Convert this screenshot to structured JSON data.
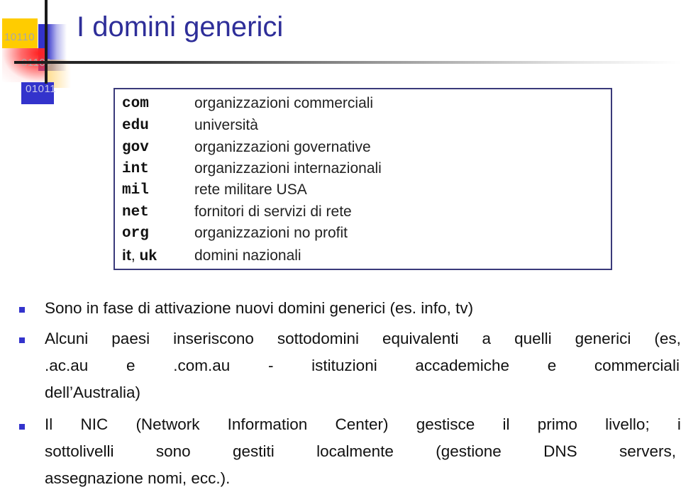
{
  "logo": {
    "binary_labels": [
      "10110",
      "01100",
      "01011"
    ],
    "colors": {
      "yellow": "#ffcc00",
      "blue": "#3333cc",
      "red": "#ff2020"
    }
  },
  "title": "I domini generici",
  "colors": {
    "title": "#2e2e99",
    "bullet": "#3333cc",
    "box_border": "#3a3a7a"
  },
  "tld_table": [
    {
      "code": "com",
      "desc": "organizzazioni commerciali"
    },
    {
      "code": "edu",
      "desc": "università"
    },
    {
      "code": "gov",
      "desc": "organizzazioni governative"
    },
    {
      "code": "int",
      "desc": "organizzazioni internazionali"
    },
    {
      "code": "mil",
      "desc": "rete militare USA"
    },
    {
      "code": "net",
      "desc": "fornitori di servizi di rete"
    },
    {
      "code": "org",
      "desc": "organizzazioni no profit"
    },
    {
      "code_a": "it",
      "code_sep": ", ",
      "code_b": "uk",
      "desc": "domini nazionali"
    }
  ],
  "bullets": [
    {
      "lines": [
        "Sono in fase di attivazione nuovi domini generici (es. info, tv)"
      ]
    },
    {
      "lines": [
        [
          "Alcuni",
          "paesi",
          "inseriscono",
          "sottodomini",
          "equivalenti",
          "a",
          "quelli",
          "generici",
          "(es,"
        ],
        [
          ".ac.au",
          "e",
          ".com.au",
          "-",
          "istituzioni",
          "accademiche",
          "e",
          "commerciali"
        ],
        "dell’Australia)"
      ]
    },
    {
      "lines": [
        [
          "Il",
          "NIC",
          "(Network",
          "Information",
          "Center)",
          "gestisce",
          "il",
          "primo",
          "livello;",
          "i"
        ],
        [
          "sottolivelli",
          "sono",
          "gestiti",
          "localmente",
          "(gestione",
          "DNS",
          "servers,"
        ],
        "assegnazione nomi, ecc.)."
      ]
    }
  ]
}
